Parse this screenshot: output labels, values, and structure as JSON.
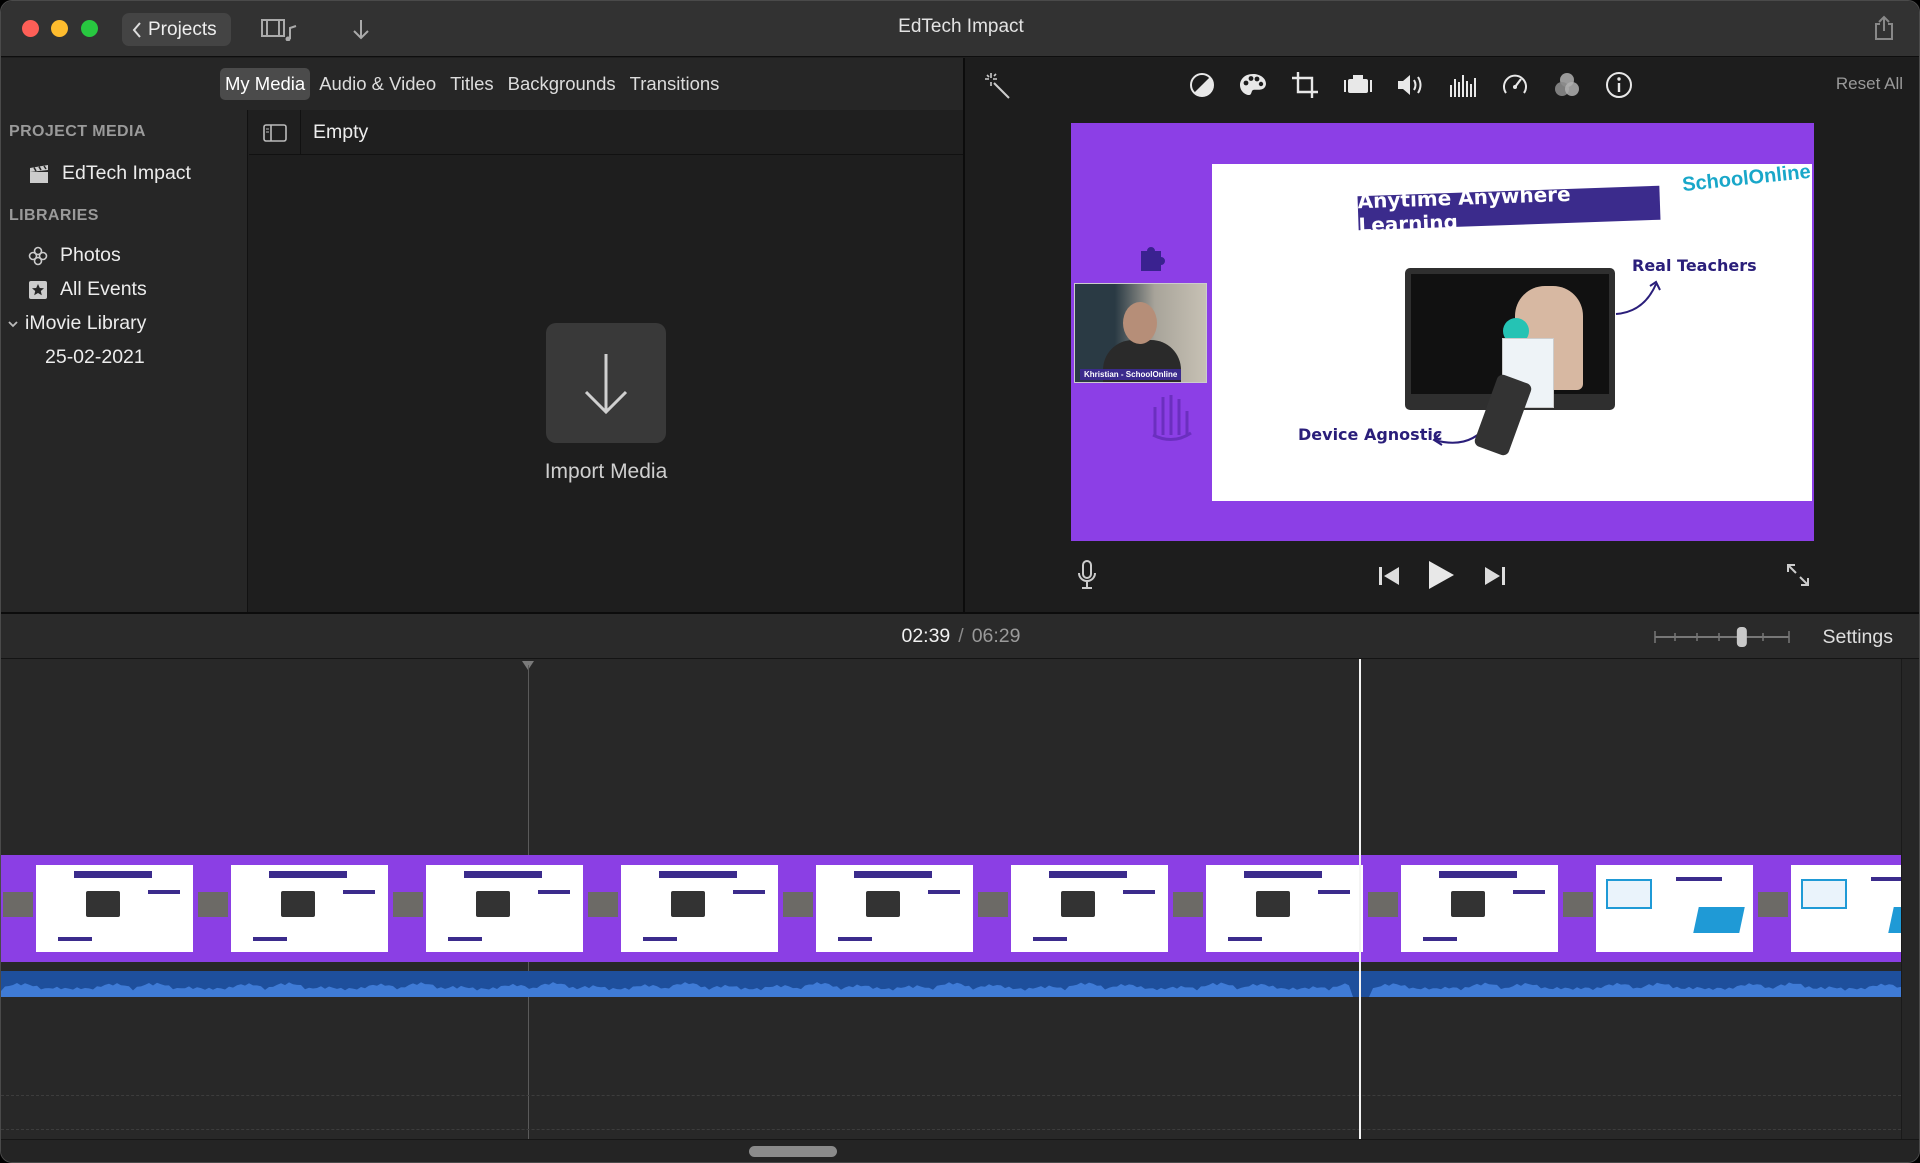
{
  "window": {
    "title": "EdTech Impact"
  },
  "toolbar": {
    "projects_label": "Projects"
  },
  "media_tabs": [
    "My Media",
    "Audio & Video",
    "Titles",
    "Backgrounds",
    "Transitions"
  ],
  "active_media_tab": "My Media",
  "sidebar": {
    "project_media_header": "PROJECT MEDIA",
    "project_item": "EdTech Impact",
    "libraries_header": "LIBRARIES",
    "items": [
      {
        "label": "Photos",
        "icon": "photos-icon"
      },
      {
        "label": "All Events",
        "icon": "star-icon"
      },
      {
        "label": "iMovie Library",
        "icon": "disclosure-chevron-icon"
      },
      {
        "label": "25-02-2021",
        "icon": ""
      }
    ]
  },
  "browser": {
    "filter_label": "Empty",
    "import_label": "Import Media"
  },
  "viewer": {
    "reset_all": "Reset All",
    "adjustment_icons": [
      "color-balance-icon",
      "color-correction-icon",
      "crop-icon",
      "stabilization-icon",
      "volume-icon",
      "equalizer-icon",
      "speed-icon",
      "clip-filter-icon",
      "info-icon"
    ]
  },
  "preview": {
    "title": "Anytime Anywhere Learning",
    "label_teachers": "Real Teachers",
    "label_device": "Device Agnostic",
    "logo_line1": "School",
    "logo_line2": "Online",
    "webcam_tag": "Khristian - SchoolOnline"
  },
  "timecode": {
    "current": "02:39",
    "separator": "/",
    "total": "06:29"
  },
  "timeline": {
    "settings_label": "Settings",
    "zoom_level": 0.66
  },
  "colors": {
    "accent_purple": "#8c3fe6",
    "audio_blue": "#1e4f9c",
    "close": "#fe5f57",
    "minimize": "#febc2e",
    "zoom": "#28c840"
  }
}
